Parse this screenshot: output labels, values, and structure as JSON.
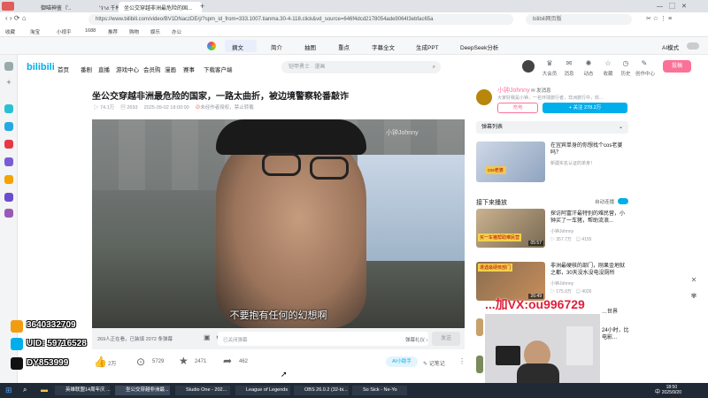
{
  "tabs": [
    {
      "label": "御喵神鉴（'.."
    },
    {
      "label": "'ว่าง   千杯..."
    },
    {
      "label": "坐公交穿越非洲最危险的国..."
    }
  ],
  "browser": {
    "url": "https://www.bilibili.com/video/BV1DNaczDErj/?spm_id_from=333.1007.tianma.30-4-118.click&vd_source=646f4dcd2178054ade9064I3ebfac65a",
    "search_placeholder": "bilibili网页版"
  },
  "bookmarks": [
    "收藏",
    "淘宝",
    "小视乎",
    "1688",
    "推荐",
    "购物",
    "娱乐",
    "办公"
  ],
  "toolstrip": {
    "items": [
      "摘文",
      "简介",
      "抽图",
      "重点",
      "字幕全文",
      "生成PPT",
      "DeepSeek分析"
    ],
    "ai_mode": "AI模式"
  },
  "bili": {
    "logo": "bilibili",
    "nav": [
      "首页",
      "番剧",
      "直播",
      "游戏中心",
      "会员购",
      "漫画",
      "赛事",
      "下载客户端"
    ],
    "search_placeholder": "铠甲勇士 · 漫画",
    "header_icons": [
      "大会员",
      "消息",
      "动态",
      "收藏",
      "历史",
      "创作中心"
    ],
    "upload": "投稿"
  },
  "video": {
    "title": "坐公交穿越非洲最危险的国家，一路太曲折，被边境警察轮番敲诈",
    "views": "74.1万",
    "danmaku_count": "2693",
    "date": "2025-09-02 18:00:00",
    "notice": "未经作者授权，禁止转载",
    "watermark": "小钟Johnny",
    "subtitle": "不要抱有任何的幻想啊",
    "watching": "269人正在看，已装填 2072 条弹幕",
    "danmaku_placeholder": "已关闭弹幕",
    "etiquette": "弹幕礼仪 ›",
    "send": "发送",
    "likes": "2万",
    "coins": "5729",
    "favs": "2471",
    "shares": "462",
    "ai": "AI小助手",
    "notes": "记笔记"
  },
  "uploader": {
    "name": "小钟Johnny",
    "tag": "发消息",
    "desc": "大家好我是小钟，一名环球旅行者，非洲旅行中，欢...",
    "charge": "充电",
    "follow": "+ 关注 278.2万"
  },
  "danmaku_list": "弹幕列表",
  "ad": {
    "title": "在宜宾单身的你想找个cos老婆吗？",
    "source": "新疆实名认证的单身！"
  },
  "next": {
    "label": "接下来播放",
    "autoplay": "自动连播"
  },
  "cards": [
    {
      "title": "探访阿富汗最特别的难民营，小钟买了一车猪，帮助流浪...",
      "author": "小钟Johnny",
      "views": "357.7万",
      "dm": "4155",
      "duration": "05:57",
      "thumb": "买一车猪帮助难民营"
    },
    {
      "title": "非洲最硬核的部门，刚果金地狱之都，30天没水没电没厕所",
      "author": "小钟Johnny",
      "views": "175.9万",
      "dm": "4026",
      "duration": "26:49",
      "thumb": "遭遇最硬核部门"
    },
    {
      "title": "…世界",
      "author": "",
      "views": "",
      "dm": "",
      "duration": "",
      "thumb": ""
    },
    {
      "title": "24小时，比电影...",
      "author": "",
      "views": "",
      "dm": "",
      "duration": "",
      "thumb": ""
    }
  ],
  "stream": {
    "qq": "3640332709",
    "uid": "UID: 59716528",
    "douyin": "DY853999",
    "red_text": "...加VX:ou996729"
  },
  "taskbar": {
    "items": [
      "英雄联盟14周年庆 ...",
      "坐公交穿越非洲最...",
      "Studio One - 202...",
      "League of Legends",
      "OBS 26.0.2 (32-bi...",
      "So Sick - Ne-Yo"
    ],
    "lang": "中",
    "time": "18:50",
    "date": "2025/9/20"
  },
  "colors": {
    "bili_pink": "#fb7299",
    "bili_blue": "#00aeec"
  }
}
